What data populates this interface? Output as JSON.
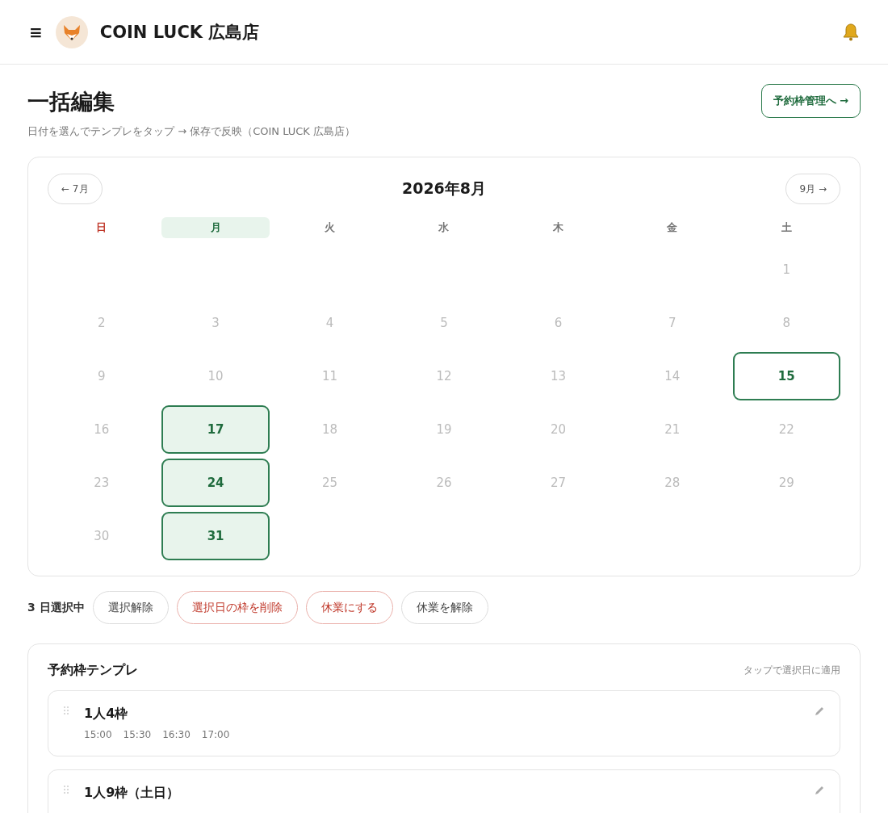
{
  "header": {
    "menu_icon": "≡",
    "store_name": "COIN LUCK 広島店"
  },
  "page": {
    "title": "一括編集",
    "subtitle": "日付を選んでテンプレをタップ → 保存で反映（COIN LUCK 広島店）",
    "link_button": "予約枠管理へ →"
  },
  "calendar": {
    "prev_button": "← 7月",
    "month": "2026年8月",
    "next_button": "9月 →",
    "weekdays": [
      {
        "label": "日",
        "kind": "sunday",
        "selected": false
      },
      {
        "label": "月",
        "kind": "weekday",
        "selected": true
      },
      {
        "label": "火",
        "kind": "weekday",
        "selected": false
      },
      {
        "label": "水",
        "kind": "weekday",
        "selected": false
      },
      {
        "label": "木",
        "kind": "weekday",
        "selected": false
      },
      {
        "label": "金",
        "kind": "weekday",
        "selected": false
      },
      {
        "label": "土",
        "kind": "weekday",
        "selected": false
      }
    ],
    "weeks": [
      [
        {
          "kind": "empty"
        },
        {
          "kind": "empty"
        },
        {
          "kind": "empty"
        },
        {
          "kind": "empty"
        },
        {
          "kind": "empty"
        },
        {
          "kind": "empty"
        },
        {
          "kind": "day",
          "label": "1",
          "selected": false,
          "today": false
        }
      ],
      [
        {
          "kind": "day",
          "label": "2",
          "selected": false,
          "today": false
        },
        {
          "kind": "day",
          "label": "3",
          "selected": false,
          "today": false
        },
        {
          "kind": "day",
          "label": "4",
          "selected": false,
          "today": false
        },
        {
          "kind": "day",
          "label": "5",
          "selected": false,
          "today": false
        },
        {
          "kind": "day",
          "label": "6",
          "selected": false,
          "today": false
        },
        {
          "kind": "day",
          "label": "7",
          "selected": false,
          "today": false
        },
        {
          "kind": "day",
          "label": "8",
          "selected": false,
          "today": false
        }
      ],
      [
        {
          "kind": "day",
          "label": "9",
          "selected": false,
          "today": false
        },
        {
          "kind": "day",
          "label": "10",
          "selected": false,
          "today": false
        },
        {
          "kind": "day",
          "label": "11",
          "selected": false,
          "today": false
        },
        {
          "kind": "day",
          "label": "12",
          "selected": false,
          "today": false
        },
        {
          "kind": "day",
          "label": "13",
          "selected": false,
          "today": false
        },
        {
          "kind": "day",
          "label": "14",
          "selected": false,
          "today": false
        },
        {
          "kind": "day",
          "label": "15",
          "selected": false,
          "today": true
        }
      ],
      [
        {
          "kind": "day",
          "label": "16",
          "selected": false,
          "today": false
        },
        {
          "kind": "day",
          "label": "17",
          "selected": true,
          "today": false
        },
        {
          "kind": "day",
          "label": "18",
          "selected": false,
          "today": false
        },
        {
          "kind": "day",
          "label": "19",
          "selected": false,
          "today": false
        },
        {
          "kind": "day",
          "label": "20",
          "selected": false,
          "today": false
        },
        {
          "kind": "day",
          "label": "21",
          "selected": false,
          "today": false
        },
        {
          "kind": "day",
          "label": "22",
          "selected": false,
          "today": false
        }
      ],
      [
        {
          "kind": "day",
          "label": "23",
          "selected": false,
          "today": false
        },
        {
          "kind": "day",
          "label": "24",
          "selected": true,
          "today": false
        },
        {
          "kind": "day",
          "label": "25",
          "selected": false,
          "today": false
        },
        {
          "kind": "day",
          "label": "26",
          "selected": false,
          "today": false
        },
        {
          "kind": "day",
          "label": "27",
          "selected": false,
          "today": false
        },
        {
          "kind": "day",
          "label": "28",
          "selected": false,
          "today": false
        },
        {
          "kind": "day",
          "label": "29",
          "selected": false,
          "today": false
        }
      ],
      [
        {
          "kind": "day",
          "label": "30",
          "selected": false,
          "today": false
        },
        {
          "kind": "day",
          "label": "31",
          "selected": true,
          "today": false
        },
        {
          "kind": "empty"
        },
        {
          "kind": "empty"
        },
        {
          "kind": "empty"
        },
        {
          "kind": "empty"
        },
        {
          "kind": "empty"
        }
      ]
    ]
  },
  "selection_bar": {
    "count_label": "3 日選択中",
    "buttons": [
      {
        "label": "選択解除",
        "kind": "neutral"
      },
      {
        "label": "選択日の枠を削除",
        "kind": "danger"
      },
      {
        "label": "休業にする",
        "kind": "danger"
      },
      {
        "label": "休業を解除",
        "kind": "neutral"
      }
    ]
  },
  "templates": {
    "title": "予約枠テンプレ",
    "hint": "タップで選択日に適用",
    "items": [
      {
        "name": "1人4枠",
        "times": [
          "15:00",
          "15:30",
          "16:30",
          "17:00"
        ]
      },
      {
        "name": "1人9枠（土日）"
      }
    ]
  }
}
